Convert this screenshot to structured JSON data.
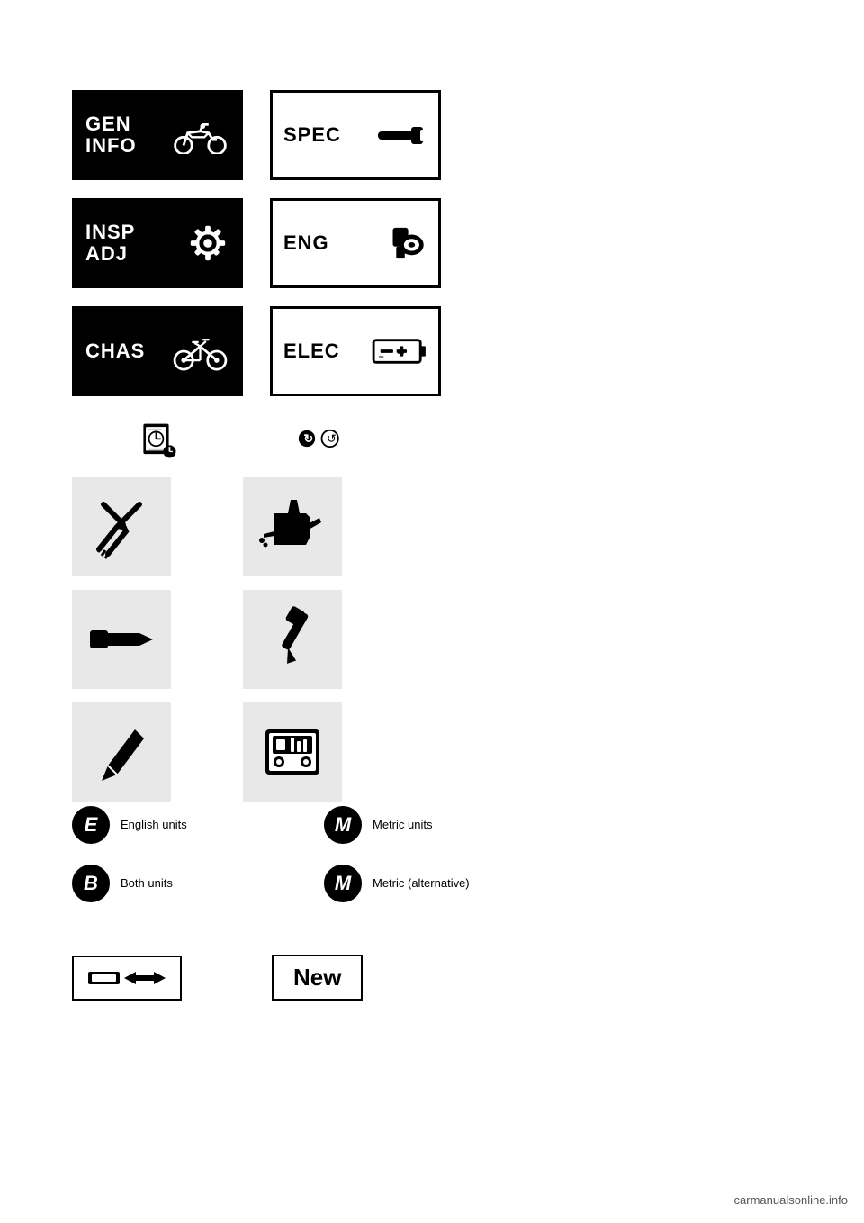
{
  "page": {
    "background": "#ffffff",
    "watermark": "carmanualsonline.info"
  },
  "categories": [
    {
      "id": "gen-info",
      "line1": "GEN",
      "line2": "INFO",
      "inverted": true,
      "icon": "motorcycle"
    },
    {
      "id": "spec",
      "line1": "SPEC",
      "line2": "",
      "inverted": false,
      "icon": "wrench-spec"
    },
    {
      "id": "insp-adj",
      "line1": "INSP",
      "line2": "ADJ",
      "inverted": true,
      "icon": "gear"
    },
    {
      "id": "eng",
      "line1": "ENG",
      "line2": "",
      "inverted": false,
      "icon": "spark"
    },
    {
      "id": "chas",
      "line1": "CHAS",
      "line2": "",
      "inverted": true,
      "icon": "bicycle"
    },
    {
      "id": "elec",
      "line1": "ELEC",
      "line2": "",
      "inverted": false,
      "icon": "battery"
    }
  ],
  "tools": [
    {
      "id": "pliers",
      "label": "Pliers tool"
    },
    {
      "id": "oil-can",
      "label": "Oil can"
    },
    {
      "id": "punch",
      "label": "Punch/drift tool"
    },
    {
      "id": "screwdriver",
      "label": "Screwdriver"
    },
    {
      "id": "chisel",
      "label": "Chisel/angle tool"
    },
    {
      "id": "meter",
      "label": "Meter/gauge"
    }
  ],
  "units": [
    {
      "symbol": "E",
      "filled": false,
      "description": "English units"
    },
    {
      "symbol": "M",
      "filled": true,
      "description": "Metric units"
    },
    {
      "symbol": "B",
      "filled": false,
      "description": "Both units"
    },
    {
      "symbol": "M",
      "filled": true,
      "description": "Metric (alternative)"
    }
  ],
  "bottom": {
    "replace_label": "Replace part",
    "new_label": "New"
  }
}
